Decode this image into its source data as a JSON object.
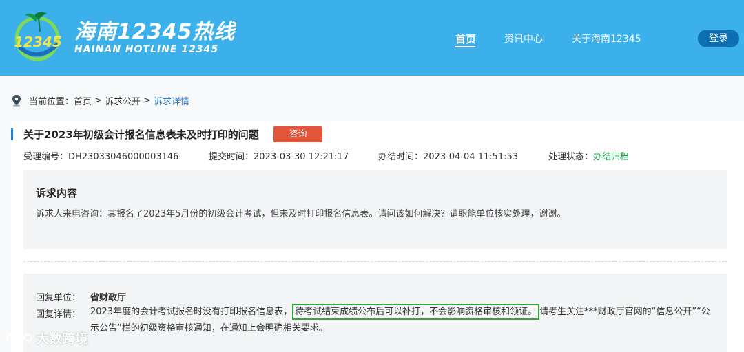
{
  "header": {
    "logo_number": "12345",
    "logo_title": "海南12345热线",
    "logo_subtitle": "HAINAN HOTLINE 12345",
    "nav": [
      {
        "label": "首页"
      },
      {
        "label": "资讯中心"
      },
      {
        "label": "关于海南12345"
      }
    ],
    "login_label": "登录"
  },
  "breadcrumb": {
    "prefix": "当前位置：",
    "items": [
      "首页",
      "诉求公开",
      "诉求详情"
    ],
    "separator": ">"
  },
  "detail": {
    "title": "关于2023年初级会计报名信息表未及时打印的问题",
    "tag": "咨询",
    "meta": [
      {
        "label": "受理编号：",
        "value": "DH23033046000003146"
      },
      {
        "label": "提交时间：",
        "value": "2023-03-30 12:21:17"
      },
      {
        "label": "办结时间：",
        "value": "2023-04-04 11:51:53"
      },
      {
        "label": "处理状态：",
        "value": "办结归档"
      }
    ],
    "appeal": {
      "heading": "诉求内容",
      "text": "诉求人来电咨询：其报名了2023年5月份的初级会计考试，但未及时打印报名信息表。请问该如何解决？请职能单位核实处理，谢谢。"
    },
    "reply": {
      "unit_label": "回复单位：",
      "unit_value": "省财政厅",
      "detail_label": "回复详情：",
      "text_before": "2023年度的会计考试报名时没有打印报名信息表，",
      "text_highlight": "待考试结束成绩公布后可以补打，不会影响资格审核和领证。",
      "text_after": "请考生关注***财政厅官网的“信息公开”“公示公告”栏的初级资格审核通知，在通知上会明确相关要求。"
    }
  },
  "watermark": "大数跨境",
  "colors": {
    "header_bg": "#3bb0ea",
    "login_bg": "#0b6fb1",
    "tag_bg": "#e2553a",
    "status_green": "#1ba24b",
    "highlight_border": "#35a83a",
    "crumb_link": "#2a7ac0"
  }
}
